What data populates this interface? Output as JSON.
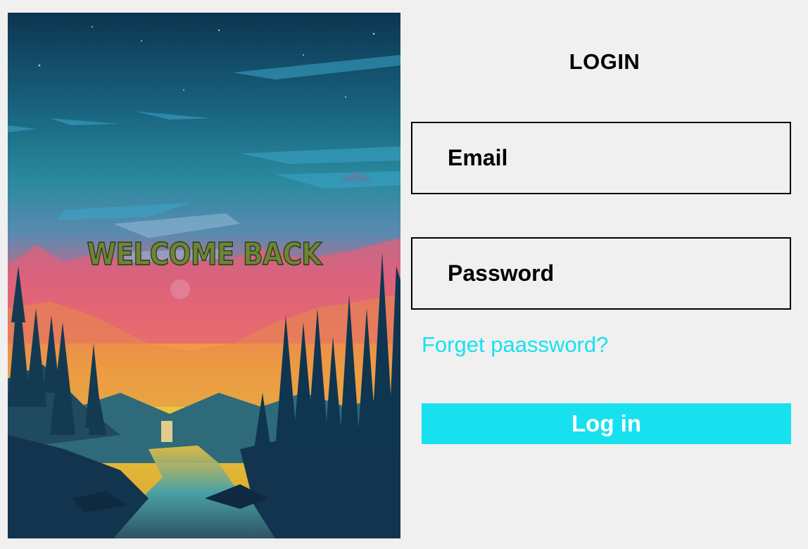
{
  "hero": {
    "image": "forest-sunset-illustration",
    "welcome_text": "WELCOME BACK"
  },
  "form": {
    "title": "LOGIN",
    "email_placeholder": "Email",
    "password_placeholder": "Password",
    "forgot_link": "Forget paassword?",
    "submit_label": "Log in"
  },
  "colors": {
    "background": "#f0f0f0",
    "accent": "#17e1ee",
    "link": "#18e0f2",
    "welcome_text": "#6f8436"
  }
}
